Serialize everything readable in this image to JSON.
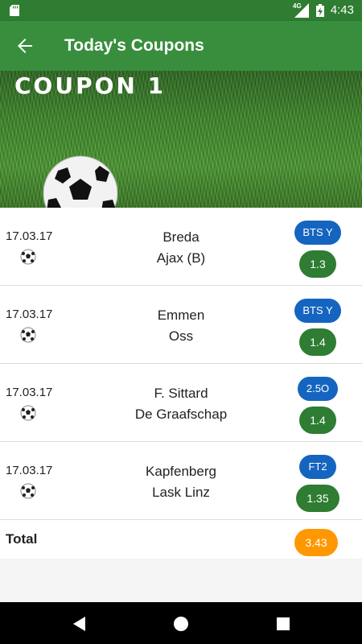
{
  "status": {
    "network": "4G",
    "time": "4:43"
  },
  "appbar": {
    "title": "Today's Coupons"
  },
  "hero": {
    "coupon_label": "COUPON 1"
  },
  "matches": [
    {
      "date": "17.03.17",
      "home": "Breda",
      "away": "Ajax (B)",
      "bet": "BTS Y",
      "odd": "1.3"
    },
    {
      "date": "17.03.17",
      "home": "Emmen",
      "away": "Oss",
      "bet": "BTS Y",
      "odd": "1.4"
    },
    {
      "date": "17.03.17",
      "home": "F. Sittard",
      "away": "De Graafschap",
      "bet": "2.5O",
      "odd": "1.4"
    },
    {
      "date": "17.03.17",
      "home": "Kapfenberg",
      "away": "Lask Linz",
      "bet": "FT2",
      "odd": "1.35"
    }
  ],
  "total": {
    "label": "Total",
    "value": "3.43"
  },
  "colors": {
    "primary": "#388e3c",
    "bet_pill": "#1565c0",
    "odd_pill": "#2e7d32",
    "total_pill": "#ff9800"
  },
  "icons": {
    "back": "arrow-left-icon",
    "sport": "soccer-ball-icon"
  }
}
